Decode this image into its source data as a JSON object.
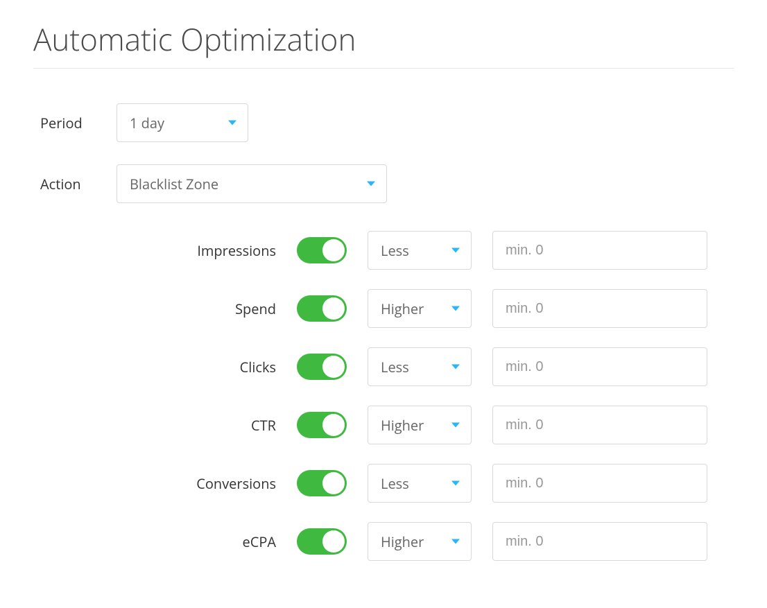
{
  "title": "Automatic Optimization",
  "period": {
    "label": "Period",
    "value": "1 day"
  },
  "action": {
    "label": "Action",
    "value": "Blacklist Zone"
  },
  "metrics": {
    "impressions": {
      "label": "Impressions",
      "condition": "Less",
      "placeholder": "min. 0",
      "enabled": true
    },
    "spend": {
      "label": "Spend",
      "condition": "Higher",
      "placeholder": "min. 0",
      "enabled": true
    },
    "clicks": {
      "label": "Clicks",
      "condition": "Less",
      "placeholder": "min. 0",
      "enabled": true
    },
    "ctr": {
      "label": "CTR",
      "condition": "Higher",
      "placeholder": "min. 0",
      "enabled": true
    },
    "conversions": {
      "label": "Conversions",
      "condition": "Less",
      "placeholder": "min. 0",
      "enabled": true
    },
    "ecpa": {
      "label": "eCPA",
      "condition": "Higher",
      "placeholder": "min. 0",
      "enabled": true
    }
  }
}
